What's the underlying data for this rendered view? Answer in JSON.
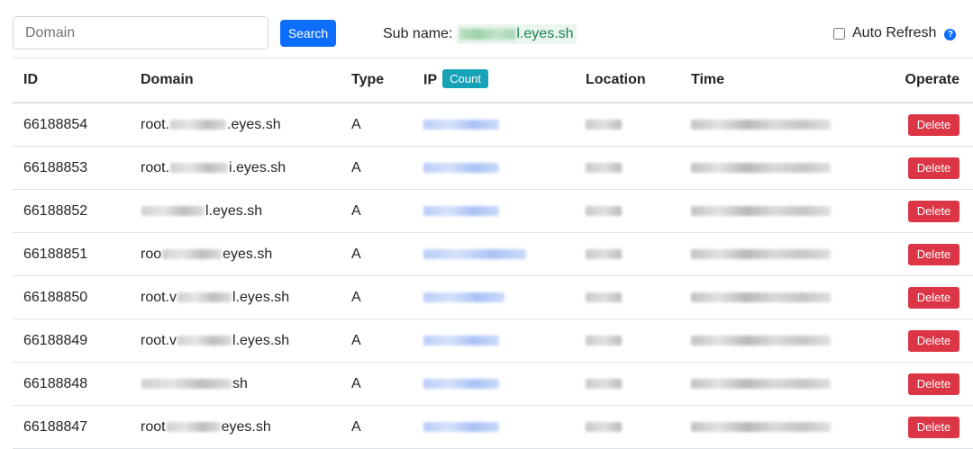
{
  "search": {
    "placeholder": "Domain",
    "value": "",
    "button_label": "Search"
  },
  "sub": {
    "label": "Sub name:",
    "value_suffix": "l.eyes.sh"
  },
  "auto_refresh": {
    "label": "Auto Refresh",
    "checked": false,
    "help_glyph": "?"
  },
  "table": {
    "headers": {
      "id": "ID",
      "domain": "Domain",
      "type": "Type",
      "ip": "IP",
      "count": "Count",
      "location": "Location",
      "time": "Time",
      "operate": "Operate"
    },
    "delete_label": "Delete",
    "rows": [
      {
        "id": "66188854",
        "domain_prefix": "root.",
        "domain_suffix": ".eyes.sh",
        "type": "A"
      },
      {
        "id": "66188853",
        "domain_prefix": "root.",
        "domain_suffix": "i.eyes.sh",
        "type": "A"
      },
      {
        "id": "66188852",
        "domain_prefix": "",
        "domain_suffix": "l.eyes.sh",
        "type": "A"
      },
      {
        "id": "66188851",
        "domain_prefix": "roo",
        "domain_suffix": "eyes.sh",
        "type": "A"
      },
      {
        "id": "66188850",
        "domain_prefix": "root.v",
        "domain_suffix": "l.eyes.sh",
        "type": "A"
      },
      {
        "id": "66188849",
        "domain_prefix": "root.v",
        "domain_suffix": "l.eyes.sh",
        "type": "A"
      },
      {
        "id": "66188848",
        "domain_prefix": "",
        "domain_suffix": "sh",
        "type": "A"
      },
      {
        "id": "66188847",
        "domain_prefix": "root",
        "domain_suffix": "eyes.sh",
        "type": "A"
      }
    ]
  },
  "icons": {
    "help": "help-circle-icon",
    "checkbox": "checkbox-unchecked"
  },
  "colors": {
    "primary": "#0d6efd",
    "danger": "#dc3545",
    "info": "#17a2b8",
    "success": "#198754"
  }
}
